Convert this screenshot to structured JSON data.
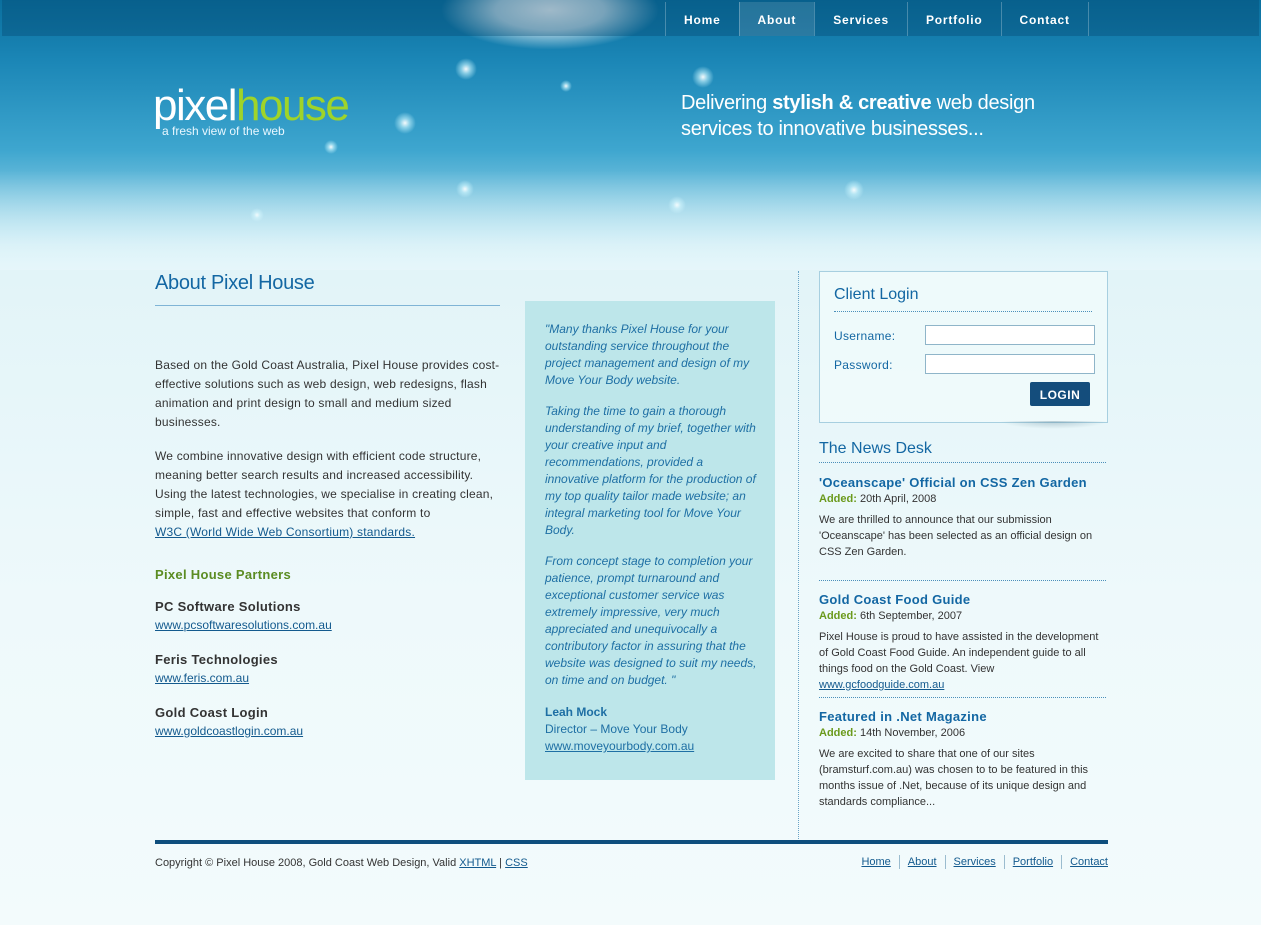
{
  "nav": [
    {
      "label": "Home"
    },
    {
      "label": "About"
    },
    {
      "label": "Services"
    },
    {
      "label": "Portfolio"
    },
    {
      "label": "Contact"
    }
  ],
  "logo": {
    "part1": "pixel",
    "part2": "house",
    "tagline": "a fresh view of the web"
  },
  "slogan": {
    "pre": "Delivering ",
    "bold": "stylish & creative",
    "post": " web design",
    "line2": "services to innovative businesses..."
  },
  "about": {
    "title": "About Pixel House",
    "p1": "Based on the Gold Coast Australia, Pixel House provides cost-effective solutions such as web design, web redesigns, flash animation and print design to small and medium sized businesses.",
    "p2": "We combine innovative design with efficient code structure, meaning better search results and increased accessibility. Using the latest technologies, we specialise in creating clean, simple, fast and effective websites that conform to",
    "w3c_link": "W3C (World Wide Web Consortium) standards."
  },
  "partners": {
    "title": "Pixel House Partners",
    "items": [
      {
        "name": "PC Software Solutions",
        "url": "www.pcsoftwaresolutions.com.au"
      },
      {
        "name": "Feris Technologies",
        "url": "www.feris.com.au"
      },
      {
        "name": "Gold Coast Login",
        "url": "www.goldcoastlogin.com.au"
      }
    ]
  },
  "testimonial": {
    "q1": "\"Many thanks Pixel House for your outstanding service throughout the project management and design of my Move Your Body website.",
    "q2": "Taking the time to gain a thorough understanding of my brief, together with your creative input and recommendations, provided a innovative platform for the production of my top quality tailor made website; an integral marketing tool for Move Your Body.",
    "q3": "From concept stage to completion your patience, prompt turnaround and exceptional customer service was extremely impressive, very much appreciated and unequivocally a contributory factor in assuring that the website was designed to suit my needs, on time and on budget. \"",
    "name": "Leah Mock",
    "role": "Director – Move Your Body",
    "url": "www.moveyourbody.com.au"
  },
  "login": {
    "title": "Client Login",
    "username_label": "Username:",
    "password_label": "Password:",
    "username_value": "",
    "password_value": "",
    "button": "LOGIN"
  },
  "news": {
    "title": "The News Desk",
    "added_label": "Added:",
    "items": [
      {
        "title": "'Oceanscape' Official on CSS Zen Garden",
        "date": "20th April, 2008",
        "body": "We are thrilled to announce that our submission 'Oceanscape' has been selected as an official design on CSS Zen Garden.",
        "link": ""
      },
      {
        "title": "Gold Coast Food Guide",
        "date": "6th September, 2007",
        "body": "Pixel House is proud to have assisted in the development of Gold Coast Food Guide. An independent guide to all things food on the Gold Coast. View ",
        "link": "www.gcfoodguide.com.au"
      },
      {
        "title": "Featured in .Net Magazine",
        "date": "14th November, 2006",
        "body": "We are excited to share that one of our sites (bramsturf.com.au) was chosen to to be featured in this months issue of .Net, because of its unique design and standards compliance...",
        "link": ""
      }
    ]
  },
  "footer": {
    "copyright": "Copyright © Pixel House 2008, Gold Coast Web Design, Valid ",
    "xhtml": "XHTML",
    "sep": " | ",
    "css": "CSS",
    "links": [
      "Home",
      "About",
      "Services",
      "Portfolio",
      "Contact"
    ]
  },
  "colors": {
    "brand_blue": "#1367a3",
    "accent_green": "#9fd429",
    "footer_bar": "#0e4e7d",
    "testimonial_bg": "#bde6ea"
  }
}
